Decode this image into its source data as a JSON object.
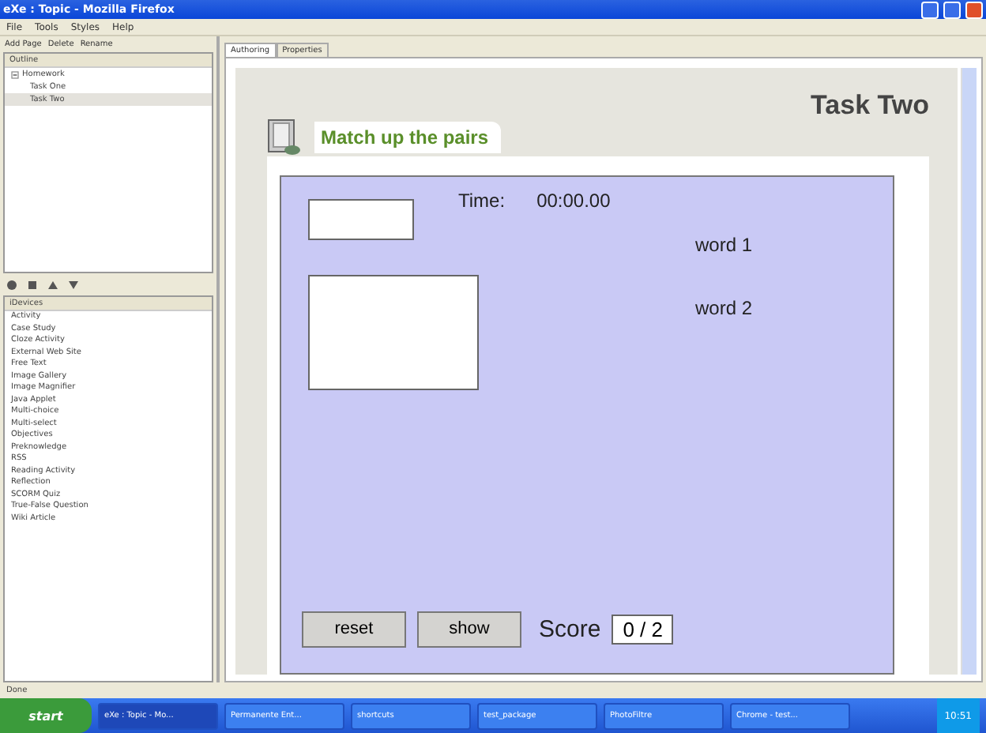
{
  "window": {
    "title": "eXe : Topic - Mozilla Firefox"
  },
  "menu": [
    "File",
    "Tools",
    "Styles",
    "Help"
  ],
  "outline_toolbar": [
    "Add Page",
    "Delete",
    "Rename"
  ],
  "outline": {
    "title": "Outline",
    "items": [
      {
        "label": "Homework",
        "expanded": true,
        "selected": false,
        "children": [
          {
            "label": "Task One",
            "selected": false
          },
          {
            "label": "Task Two",
            "selected": true
          }
        ]
      }
    ]
  },
  "idevices": {
    "title": "iDevices",
    "items": [
      "Activity",
      "Case Study",
      "Cloze Activity",
      "External Web Site",
      "Free Text",
      "Image Gallery",
      "Image Magnifier",
      "Java Applet",
      "Multi-choice",
      "Multi-select",
      "Objectives",
      "Preknowledge",
      "RSS",
      "Reading Activity",
      "Reflection",
      "SCORM Quiz",
      "True-False Question",
      "Wiki Article"
    ]
  },
  "tabs": [
    {
      "label": "Authoring",
      "selected": true
    },
    {
      "label": "Properties",
      "selected": false
    }
  ],
  "page": {
    "title": "Task Two",
    "heading": "Match up the pairs",
    "activity": {
      "time_label": "Time:",
      "time": "00:00.00",
      "words": [
        "word 1",
        "word 2"
      ],
      "buttons": [
        "reset",
        "show"
      ],
      "score_label": "Score",
      "score": "0 / 2"
    }
  },
  "status_bar": "Done",
  "taskbar": {
    "start": "start",
    "tasks": [
      "eXe : Topic - Mo...",
      "Permanente Ent...",
      "shortcuts",
      "test_package",
      "PhotoFiltre",
      "Chrome - test..."
    ],
    "clock": "10:51"
  }
}
